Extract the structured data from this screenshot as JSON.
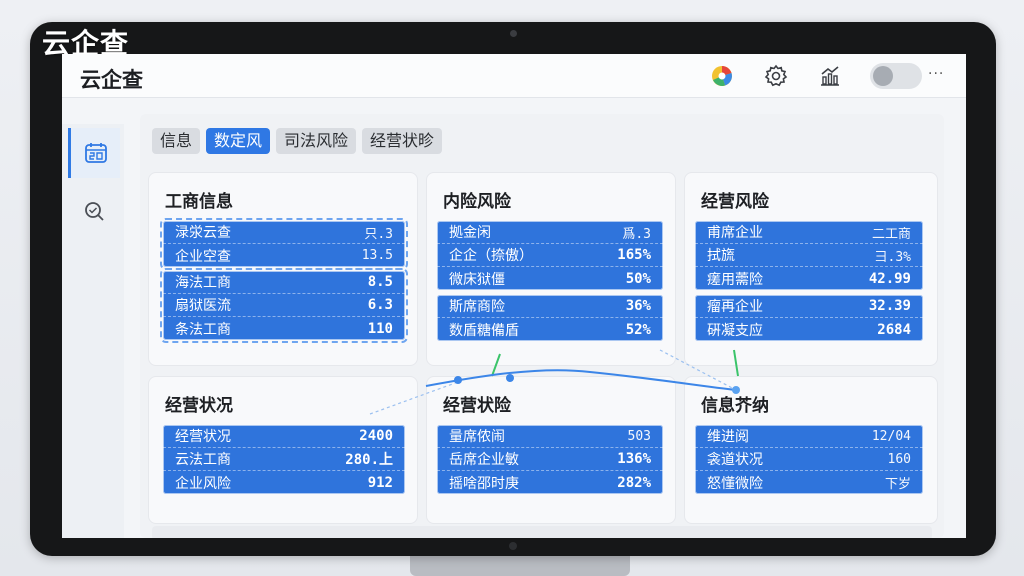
{
  "overlay": {
    "brand": "云企查"
  },
  "topbar": {
    "title": "云企查",
    "more": "···"
  },
  "tabs": [
    {
      "label": "信息"
    },
    {
      "label": "数定风"
    },
    {
      "label": "司法风险"
    },
    {
      "label": "经营状昣"
    }
  ],
  "cards": [
    {
      "title": "工商信息",
      "blocks": [
        {
          "rows": [
            {
              "label": "渌泶云查",
              "value": "只.3"
            },
            {
              "label": "企业空查",
              "value": "13.5"
            }
          ]
        },
        {
          "rows": [
            {
              "label": "海法工商",
              "value": "8.5"
            },
            {
              "label": "扇狱医流",
              "value": "6.3"
            },
            {
              "label": "条法工商",
              "value": "110"
            }
          ]
        }
      ]
    },
    {
      "title": "内险风险",
      "blocks": [
        {
          "rows": [
            {
              "label": "拠金闲",
              "value": "爲.3"
            },
            {
              "label": "企企（捺傲）",
              "value": "165%"
            },
            {
              "label": "微床狱僵",
              "value": "50%"
            }
          ]
        },
        {
          "rows": [
            {
              "label": "斯席商险",
              "value": "36%"
            },
            {
              "label": "数盾糖備盾",
              "value": "52%"
            }
          ]
        }
      ]
    },
    {
      "title": "经营风险",
      "blocks": [
        {
          "rows": [
            {
              "label": "甫席企业",
              "value": "二工商"
            },
            {
              "label": "拭旒",
              "value": "彐.3%"
            },
            {
              "label": "瘥用薷险",
              "value": "42.99"
            }
          ]
        },
        {
          "rows": [
            {
              "label": "瘤再企业",
              "value": "32.39"
            },
            {
              "label": "硏凝支应",
              "value": "2684"
            }
          ]
        }
      ]
    },
    {
      "title": "经营状况",
      "blocks": [
        {
          "rows": [
            {
              "label": "经营状况",
              "value": "2400"
            },
            {
              "label": "云法工商",
              "value": "280.上"
            },
            {
              "label": "企业风险",
              "value": "912"
            }
          ]
        }
      ]
    },
    {
      "title": "经营状险",
      "blocks": [
        {
          "rows": [
            {
              "label": "量席侬闹",
              "value": "503"
            },
            {
              "label": "岳席企业敏",
              "value": "136%"
            },
            {
              "label": "摇啥邵时庚",
              "value": "282%"
            }
          ]
        }
      ]
    },
    {
      "title": "信息芥纳",
      "blocks": [
        {
          "rows": [
            {
              "label": "维进阅",
              "value": "12/04"
            },
            {
              "label": "衾道状况",
              "value": "160"
            },
            {
              "label": "怒懂微险",
              "value": "下岁"
            }
          ]
        }
      ]
    }
  ],
  "colors": {
    "accent": "#2f78e4",
    "block": "#2f74dc",
    "connector": "#3c86e8",
    "connector_green": "#3bc46a"
  },
  "icons": [
    "color-wheel-icon",
    "gear-icon",
    "analytics-icon",
    "avatar-icon",
    "calendar-icon",
    "search-icon"
  ]
}
